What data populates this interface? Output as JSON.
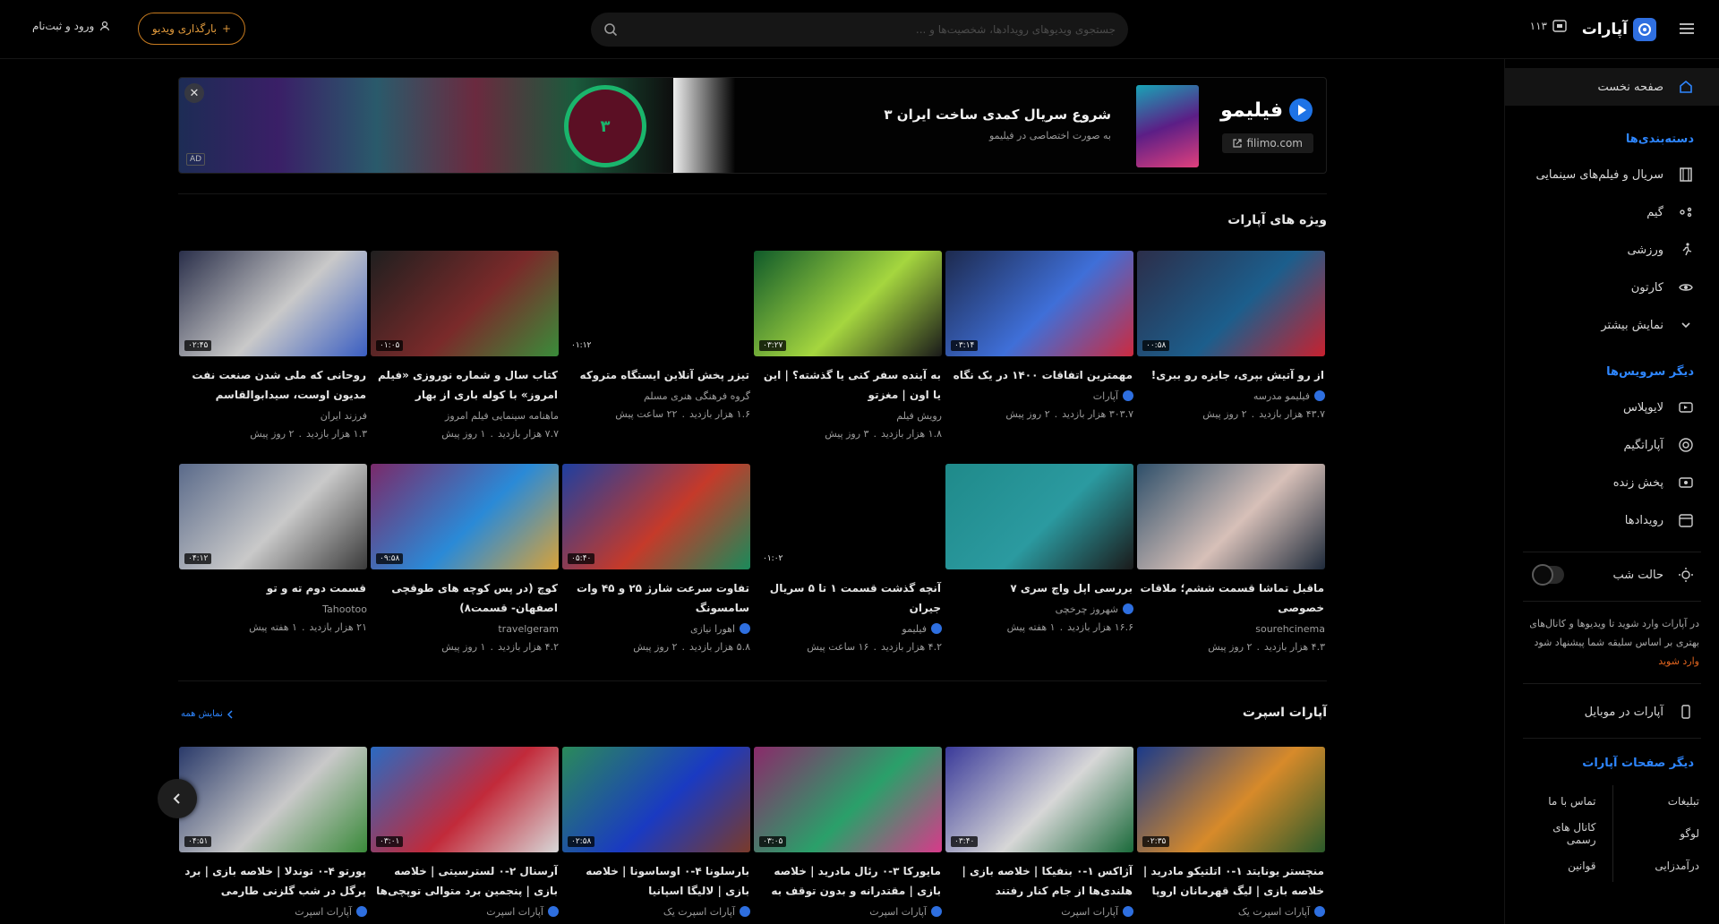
{
  "header": {
    "logo_text": "آپارات",
    "inbox_count": "۱۱۳",
    "search_placeholder": "جستجوی ویدیوهای رویدادها، شخصیت‌ها و ...",
    "upload_label": "بارگذاری ویدیو",
    "login_label": "ورود و ثبت‌نام"
  },
  "sidebar": {
    "home": "صفحه نخست",
    "categories_title": "دسته‌بندی‌ها",
    "categories": [
      "سریال و فیلم‌های سینمایی",
      "گیم",
      "ورزشی",
      "کارتون",
      "نمایش بیشتر"
    ],
    "services_title": "دیگر سرویس‌ها",
    "services": [
      "لایوپلاس",
      "آپاراتگیم",
      "پخش زنده",
      "رویدادها"
    ],
    "night_mode": "حالت شب",
    "note": "در آپارات وارد شوید تا ویدیوها و کانال‌های بهتری بر اساس سلیقه شما پیشنهاد شود",
    "note_link": "وارد شوید",
    "mobile": "آپارات در موبایل",
    "pages_title": "دیگر صفحات آپارات",
    "pages_right": [
      "تبلیغات",
      "لوگو",
      "درآمدزایی"
    ],
    "pages_left": [
      "تماس با ما",
      "کانال های رسمی",
      "قوانین"
    ]
  },
  "ad": {
    "title": "شروع سریال کمدی ساخت ایران ۳",
    "subtitle": "به صورت اختصاصی در فیلیمو",
    "brand": "فیلیمو",
    "url": "filimo.com",
    "badge": "AD"
  },
  "featured": {
    "title": "ویژه های آپارات",
    "rows": [
      [
        {
          "title": "از رو آتیش بپری، جایزه رو ببری!",
          "channel": "فیلیمو مدرسه",
          "verified": true,
          "views": "۴۳.۷ هزار بازدید",
          "time": "۲ روز پیش",
          "duration": "۰۰:۵۸",
          "colors": [
            "#2c2e4a",
            "#1c5e8c",
            "#c7212f"
          ]
        },
        {
          "title": "مهمترین اتفاقات ۱۴۰۰ در یک نگاه",
          "channel": "آپارات",
          "verified": true,
          "views": "۳۰۳.۷ هزار بازدید",
          "time": "۲ روز پیش",
          "duration": "۰۳:۱۴",
          "colors": [
            "#1d2a4e",
            "#3f6fd8",
            "#cc2a3f"
          ]
        },
        {
          "title": "به آینده سفر کنی یا گذشته؟ | این یا اون | مغزتو",
          "channel": "رویش فیلم",
          "verified": false,
          "views": "۱.۸ هزار بازدید",
          "time": "۳ روز پیش",
          "duration": "۰۳:۲۷",
          "colors": [
            "#0f5a2a",
            "#a5d63f",
            "#1a1a1a"
          ]
        },
        {
          "title": "تیزر پخش آنلاین ایستگاه متروکه",
          "channel": "گروه فرهنگی هنری مسلم",
          "verified": false,
          "views": "۱.۶ هزار بازدید",
          "time": "۲۲ ساعت پیش",
          "duration": "۰۱:۱۲",
          "colors": [
            "#000000",
            "#000000",
            "#000000"
          ]
        },
        {
          "title": "کتاب سال و شماره نوروزی «فیلم امروز» با کوله باری از بهار",
          "channel": "ماهنامه سینمایی فیلم امروز",
          "verified": false,
          "views": "۷.۷ هزار بازدید",
          "time": "۱ روز پیش",
          "duration": "۰۱:۰۵",
          "colors": [
            "#1f1f1f",
            "#7a2a2a",
            "#3a8c3a"
          ]
        },
        {
          "title": "روحانی که ملی شدن صنعت نفت مدیون اوست، سیدابوالقاسم کاشانی",
          "channel": "فرزند ایران",
          "verified": false,
          "views": "۱.۳ هزار بازدید",
          "time": "۲ روز پیش",
          "duration": "۰۲:۴۵",
          "colors": [
            "#2a2f4a",
            "#c9c9c9",
            "#3a5ec2"
          ]
        }
      ],
      [
        {
          "title": "ماقبل تماشا قسمت ششم؛ ملاقات خصوصی",
          "channel": "sourehcinema",
          "verified": false,
          "views": "۴.۳ هزار بازدید",
          "time": "۲ روز پیش",
          "duration": "",
          "colors": [
            "#2e4f6a",
            "#d7c0b8",
            "#1e2a3a"
          ]
        },
        {
          "title": "بررسی اپل واچ سری ۷",
          "channel": "شهروز چرخچی",
          "verified": true,
          "views": "۱۶.۶ هزار بازدید",
          "time": "۱ هفته پیش",
          "duration": "",
          "colors": [
            "#1f8a8a",
            "#2b9aa0",
            "#1a1a1a"
          ]
        },
        {
          "title": "آنچه گذشت قسمت ۱ تا ۵ سریال جیران",
          "channel": "فیلیمو",
          "verified": true,
          "views": "۴.۲ هزار بازدید",
          "time": "۱۶ ساعت پیش",
          "duration": "۰۱:۰۲",
          "colors": [
            "#000000",
            "#000000",
            "#000000"
          ]
        },
        {
          "title": "تفاوت سرعت شارژ ۲۵ و ۴۵ وات سامسونگ",
          "channel": "اهورا نیازی",
          "verified": true,
          "views": "۵.۸ هزار بازدید",
          "time": "۲ روز پیش",
          "duration": "۰۵:۴۰",
          "colors": [
            "#1e3fa0",
            "#c53a2a",
            "#1a8a5a"
          ]
        },
        {
          "title": "کوچ (در پس کوچه های طوقچی اصفهان- قسمت۸)",
          "channel": "travelgeram",
          "verified": false,
          "views": "۴.۲ هزار بازدید",
          "time": "۱ روز پیش",
          "duration": "۰۹:۵۸",
          "colors": [
            "#7a2a6a",
            "#2a8ad7",
            "#d7a23a"
          ]
        },
        {
          "title": "قسمت دوم ته و تو",
          "channel": "Tahootoo",
          "verified": false,
          "views": "۲۱ هزار بازدید",
          "time": "۱ هفته پیش",
          "duration": "۰۴:۱۲",
          "colors": [
            "#5a6a8a",
            "#c9c9c9",
            "#3a3a3a"
          ]
        }
      ]
    ]
  },
  "sport": {
    "title": "آپارات اسپرت",
    "see_all": "نمایش همه",
    "items": [
      {
        "title": "منچستر یونایتد ۱-۰ اتلتیکو مادرید | خلاصه بازی | لیگ قهرمانان اروپا",
        "channel": "آپارات اسپرت یک",
        "duration": "۰۲:۳۵",
        "colors": [
          "#1a3a8a",
          "#d78a2a",
          "#2a5a2a"
        ]
      },
      {
        "title": "آژاکس ۱-۰ بنفیکا | خلاصه بازی | هلندی‌ها از جام کنار رفتند",
        "channel": "آپارات اسپرت",
        "duration": "۰۳:۴۰",
        "colors": [
          "#3a3a9a",
          "#d7d7d7",
          "#1a6a3a"
        ]
      },
      {
        "title": "مایورکا ۳-۰ رئال مادرید | خلاصه بازی | مقتدرانه و بدون توقف به سوی قهرمانی",
        "channel": "آپارات اسپرت",
        "duration": "۰۳:۰۵",
        "colors": [
          "#8a2a6a",
          "#2aa06a",
          "#d73a8a"
        ]
      },
      {
        "title": "بارسلونا ۴-۰ اوساسونا | خلاصه بازی | لالیگا اسپانیا",
        "channel": "آپارات اسپرت یک",
        "duration": "۰۲:۵۸",
        "colors": [
          "#2a8a5a",
          "#1a3ac2",
          "#7a3a2a"
        ]
      },
      {
        "title": "آرسنال ۲-۰ لسترسیتی | خلاصه بازی | پنجمین برد متوالی توپچی‌ها",
        "channel": "آپارات اسپرت",
        "duration": "۰۳:۰۱",
        "colors": [
          "#2a6ac2",
          "#c22a3a",
          "#d7d7d7"
        ]
      },
      {
        "title": "پورتو ۴-۰ توندلا | خلاصه بازی | برد پرگل در شب گلزنی طارمی",
        "channel": "آپارات اسپرت",
        "duration": "۰۴:۵۱",
        "colors": [
          "#2a3a6a",
          "#c9c9c9",
          "#3a8a3a"
        ]
      }
    ]
  }
}
